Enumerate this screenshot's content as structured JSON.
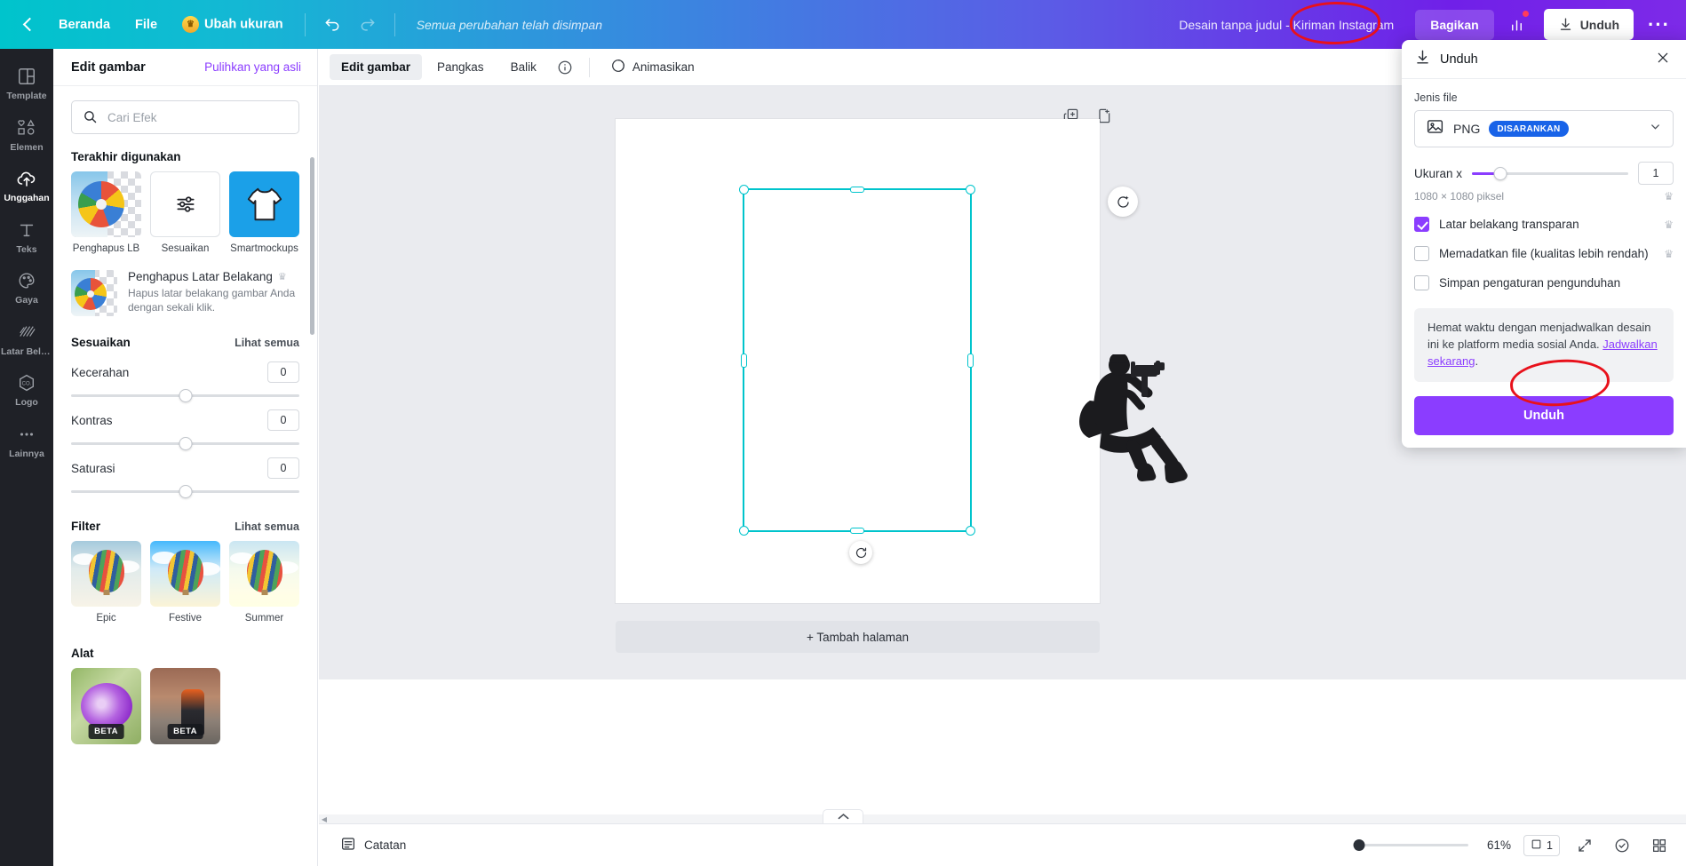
{
  "topbar": {
    "home_label": "Beranda",
    "file_label": "File",
    "resize_label": "Ubah ukuran",
    "save_status": "Semua perubahan telah disimpan",
    "doc_title": "Desain tanpa judul - Kiriman Instagram",
    "share_label": "Bagikan",
    "download_label": "Unduh",
    "more_label": "···",
    "icons": {
      "back": "chevron-left-icon",
      "undo": "undo-icon",
      "redo": "redo-icon",
      "crown": "crown-icon",
      "stats": "bar-chart-icon",
      "download": "download-arrow-icon"
    }
  },
  "rail": {
    "items": [
      {
        "label": "Template",
        "icon": "template-grid-icon",
        "active": false
      },
      {
        "label": "Elemen",
        "icon": "shapes-icon",
        "active": false
      },
      {
        "label": "Unggahan",
        "icon": "cloud-upload-icon",
        "active": true
      },
      {
        "label": "Teks",
        "icon": "text-t-icon",
        "active": false
      },
      {
        "label": "Gaya",
        "icon": "palette-icon",
        "active": false
      },
      {
        "label": "Latar Bela...",
        "icon": "hatch-pattern-icon",
        "active": false
      },
      {
        "label": "Logo",
        "icon": "hexagon-co-icon",
        "active": false
      },
      {
        "label": "Lainnya",
        "icon": "ellipsis-icon",
        "active": false
      }
    ]
  },
  "panel": {
    "title": "Edit gambar",
    "restore_label": "Pulihkan yang asli",
    "search_placeholder": "Cari Efek",
    "recent": {
      "title": "Terakhir digunakan",
      "items": [
        {
          "label": "Penghapus LB",
          "kind": "beachball"
        },
        {
          "label": "Sesuaikan",
          "kind": "sliders"
        },
        {
          "label": "Smartmockups",
          "kind": "mockup"
        }
      ]
    },
    "promo": {
      "name": "Penghapus Latar Belakang",
      "desc": "Hapus latar belakang gambar Anda dengan sekali klik.",
      "crown": "♛"
    },
    "adjust": {
      "title": "Sesuaikan",
      "see_all": "Lihat semua",
      "sliders": [
        {
          "label": "Kecerahan",
          "value": "0"
        },
        {
          "label": "Kontras",
          "value": "0"
        },
        {
          "label": "Saturasi",
          "value": "0"
        }
      ]
    },
    "filter": {
      "title": "Filter",
      "see_all": "Lihat semua",
      "items": [
        {
          "label": "Epic",
          "variant": "epic"
        },
        {
          "label": "Festive",
          "variant": "festive"
        },
        {
          "label": "Summer",
          "variant": "summer"
        }
      ]
    },
    "tools": {
      "title": "Alat",
      "items": [
        {
          "badge": "BETA",
          "variant": "flower"
        },
        {
          "badge": "BETA",
          "variant": "street"
        }
      ]
    }
  },
  "editor_toolbar": {
    "tabs": [
      {
        "label": "Edit gambar",
        "active": true
      },
      {
        "label": "Pangkas",
        "active": false
      },
      {
        "label": "Balik",
        "active": false
      }
    ],
    "info_icon": "info-circle-icon",
    "animate_label": "Animasikan",
    "animate_icon": "animate-icon"
  },
  "stage": {
    "duplicate_icon": "duplicate-page-icon",
    "addpage_icon": "add-page-icon",
    "magic_icon": "magic-wand-icon",
    "rotate_icon": "rotate-icon",
    "add_page_label": "+ Tambah halaman"
  },
  "download_panel": {
    "title": "Unduh",
    "close_icon": "close-icon",
    "download_icon": "download-arrow-icon",
    "filetype_label": "Jenis file",
    "filetype_value": "PNG",
    "filetype_badge": "DISARANKAN",
    "filetype_icon": "image-icon",
    "chevron_icon": "chevron-down-icon",
    "size_label": "Ukuran x",
    "size_value": "1",
    "pixels_text": "1080 × 1080 piksel",
    "crown": "♛",
    "options": [
      {
        "label": "Latar belakang transparan",
        "checked": true,
        "pro": true
      },
      {
        "label": "Memadatkan file (kualitas lebih rendah)",
        "checked": false,
        "pro": true
      },
      {
        "label": "Simpan pengaturan pengunduhan",
        "checked": false,
        "pro": false
      }
    ],
    "tip_text_before": "Hemat waktu dengan menjadwalkan desain ini ke platform media sosial Anda. ",
    "tip_link": "Jadwalkan sekarang",
    "tip_text_after": ".",
    "button_label": "Unduh"
  },
  "bottombar": {
    "notes_label": "Catatan",
    "notes_icon": "notes-icon",
    "zoom_percent": "61%",
    "page_count": "1",
    "page_icon": "pages-icon",
    "expand_icon": "fullscreen-icon",
    "help_icon": "help-circle-icon",
    "grid_icon": "grid-icon"
  },
  "colors": {
    "brand_purple": "#8b3dff",
    "brand_teal": "#00c4cc",
    "selection": "#00c4cc",
    "annotation_red": "#e8111b",
    "badge_blue": "#1863e8"
  }
}
